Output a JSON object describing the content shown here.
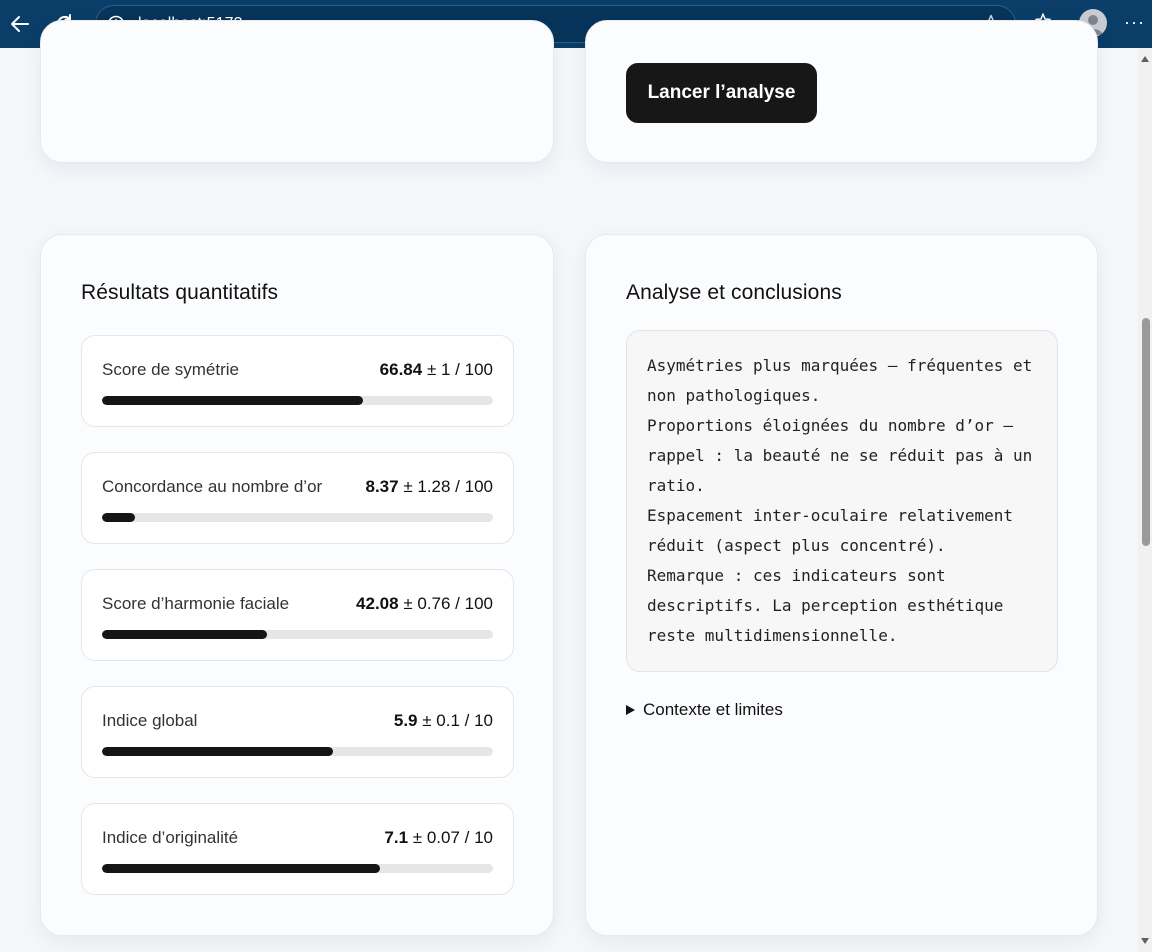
{
  "browser": {
    "url": "localhost:5173",
    "read_aloud_glyph": "aあ"
  },
  "actions": {
    "launch_label": "Lancer l’analyse"
  },
  "results": {
    "title": "Résultats quantitatifs",
    "metrics": [
      {
        "label": "Score de symétrie",
        "value": "66.84",
        "pm": "± 1 / 100",
        "fraction": 0.6684
      },
      {
        "label": "Concordance au nombre d’or",
        "value": "8.37",
        "pm": "± 1.28 / 100",
        "fraction": 0.0837
      },
      {
        "label": "Score d’harmonie faciale",
        "value": "42.08",
        "pm": "± 0.76 / 100",
        "fraction": 0.4208
      },
      {
        "label": "Indice global",
        "value": "5.9",
        "pm": "± 0.1 / 10",
        "fraction": 0.59
      },
      {
        "label": "Indice d’originalité",
        "value": "7.1",
        "pm": "± 0.07 / 10",
        "fraction": 0.71
      }
    ]
  },
  "analysis": {
    "title": "Analyse et conclusions",
    "lines": [
      "Asymétries plus marquées — fréquentes et",
      "non pathologiques.",
      "Proportions éloignées du nombre d’or —",
      "rappel : la beauté ne se réduit pas à un",
      "ratio.",
      "Espacement inter-oculaire relativement",
      "réduit (aspect plus concentré).",
      "Remarque : ces indicateurs sont",
      "descriptifs. La perception esthétique",
      "reste multidimensionnelle."
    ],
    "details_label": "Contexte et limites"
  },
  "colors": {
    "chrome": "#0a3d67",
    "button": "#171717",
    "bar_fill": "#151515",
    "bar_track": "#e6e6e6"
  }
}
